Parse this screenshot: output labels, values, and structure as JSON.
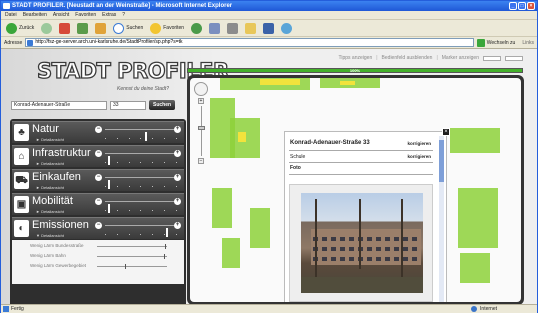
{
  "window": {
    "title": "STADT PROFILER. [Neustadt an der Weinstraße] - Microsoft Internet Explorer",
    "controls": [
      "_",
      "□",
      "×"
    ]
  },
  "menu": [
    "Datei",
    "Bearbeiten",
    "Ansicht",
    "Favoriten",
    "Extras",
    "?"
  ],
  "toolbar": {
    "back": "Zurück",
    "search": "Suchen",
    "favorites": "Favoriten"
  },
  "address": {
    "label": "Adresse",
    "url": "http://fsz-ge-server.arch.uni-karlsruhe.de/StadtProfiler/sp.php?s=tk",
    "go": "Wechseln zu",
    "links": "Links"
  },
  "app": {
    "top_links": [
      "Tipps anzeigen",
      "Bedienfeld ausblenden",
      "Marker anzeigen"
    ],
    "logo": "STADT PROFILER",
    "tagline": "Kennst du deine Stadt?",
    "progress_label": "100%",
    "progress_value": 100,
    "search": {
      "street": "Konrad-Adenauer-Straße",
      "number": "33",
      "button": "Suchen"
    },
    "categories": [
      {
        "name": "Natur",
        "sub": "Detailansicht",
        "icon": "tree-icon",
        "level": 0.55
      },
      {
        "name": "Infrastruktur",
        "sub": "Detailansicht",
        "icon": "building-icon",
        "level": 0.04
      },
      {
        "name": "Einkaufen",
        "sub": "Detailansicht",
        "icon": "cart-icon",
        "level": 0.04
      },
      {
        "name": "Mobilität",
        "sub": "Detailansicht",
        "icon": "vehicle-icon",
        "level": 0.04
      },
      {
        "name": "Emissionen",
        "sub": "Detailansicht",
        "icon": "noise-icon",
        "level": 0.85
      }
    ],
    "sub_sliders": [
      {
        "label": "Wenig Lärm Bundesstraße",
        "level": 0.97
      },
      {
        "label": "Wenig Lärm Bahn",
        "level": 0.95
      },
      {
        "label": "Wenig Lärm Gewerbegebiet",
        "level": 0.4
      }
    ],
    "info": {
      "title": "Konrad-Adenauer-Straße 33",
      "action": "korrigieren",
      "school": "Schule",
      "photo_label": "Foto",
      "footer_action": "korrigieren",
      "close": "×"
    }
  },
  "status": {
    "text": "Fertig",
    "zone": "Internet"
  }
}
